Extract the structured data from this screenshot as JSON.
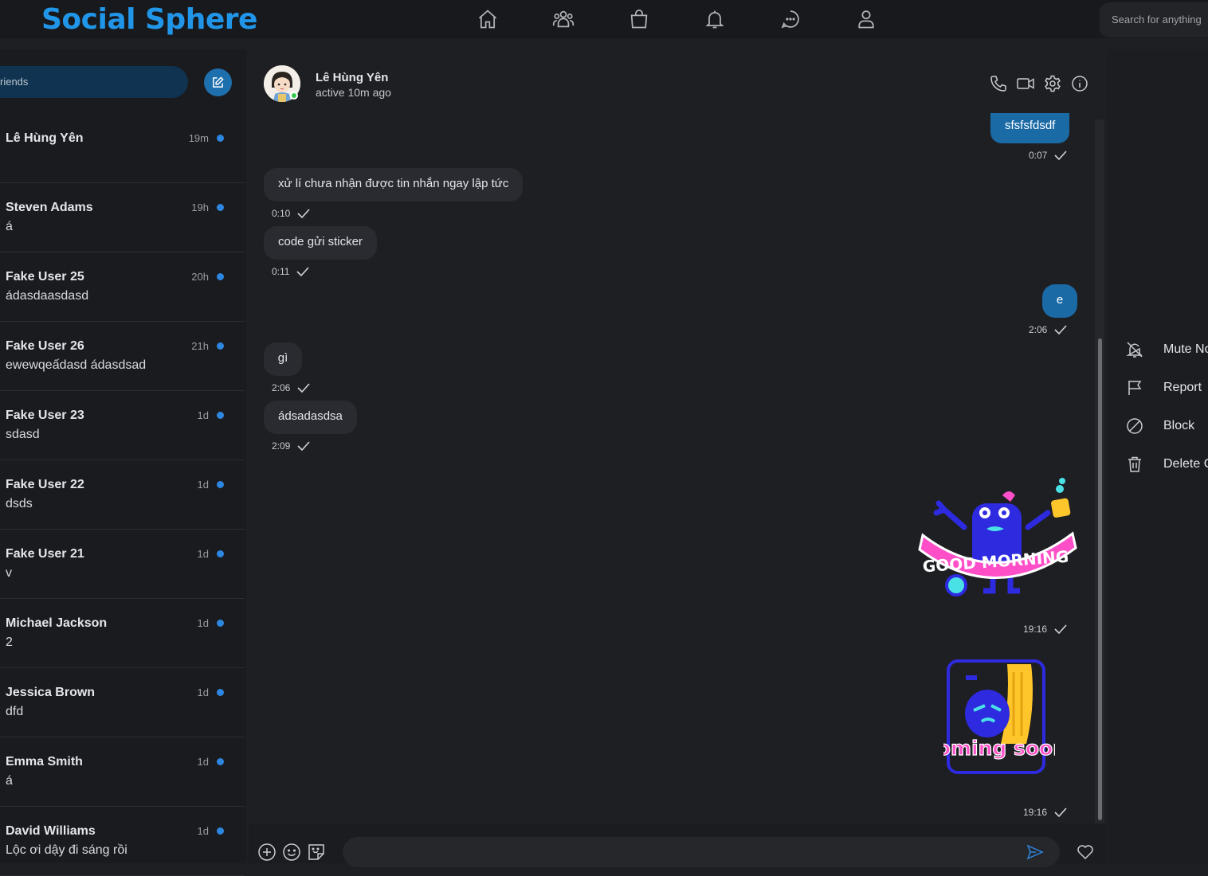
{
  "app": {
    "brand": "Social Sphere",
    "search_placeholder": "Search for anything"
  },
  "nav": [
    "home-icon",
    "friends-icon",
    "shop-icon",
    "bell-icon",
    "chat-icon",
    "profile-icon"
  ],
  "sidebar": {
    "search_placeholder": "riends",
    "conversations": [
      {
        "name": "Lê Hùng Yên",
        "preview": "",
        "time": "19m"
      },
      {
        "name": "Steven Adams",
        "preview": "á",
        "time": "19h"
      },
      {
        "name": "Fake User 25",
        "preview": "ádasdaasdasd",
        "time": "20h"
      },
      {
        "name": "Fake User 26",
        "preview": "ewewqeấdasd ádasdsad",
        "time": "21h"
      },
      {
        "name": "Fake User 23",
        "preview": "sdasd",
        "time": "1d"
      },
      {
        "name": "Fake User 22",
        "preview": "dsds",
        "time": "1d"
      },
      {
        "name": "Fake User 21",
        "preview": "v",
        "time": "1d"
      },
      {
        "name": "Michael Jackson",
        "preview": "2",
        "time": "1d"
      },
      {
        "name": "Jessica Brown",
        "preview": "dfd",
        "time": "1d"
      },
      {
        "name": "Emma Smith",
        "preview": "á",
        "time": "1d"
      },
      {
        "name": "David Williams",
        "preview": "Lộc ơi dậy đi sáng rồi",
        "time": "1d"
      }
    ]
  },
  "chat": {
    "contact_name": "Lê Hùng Yên",
    "contact_status": "active 10m ago",
    "messages": [
      {
        "direction": "out",
        "text": "sfsfsfdsdf",
        "time": "0:07"
      },
      {
        "direction": "in",
        "text": "xử lí chưa nhận được tin nhắn ngay lập tức",
        "time": "0:10"
      },
      {
        "direction": "in",
        "text": "code gửi sticker",
        "time": "0:11"
      },
      {
        "direction": "out",
        "text": "e",
        "time": "2:06"
      },
      {
        "direction": "in",
        "text": "gì",
        "time": "2:06"
      },
      {
        "direction": "in",
        "text": "ádsadasdsa",
        "time": "2:09"
      },
      {
        "direction": "out",
        "sticker": "good-morning",
        "sticker_text": "GOOD MORNING",
        "time": "19:16"
      },
      {
        "direction": "out",
        "sticker": "coming-soon",
        "sticker_text": "coming soon",
        "time": "19:16"
      }
    ]
  },
  "actions": [
    {
      "label": "Mute No",
      "icon": "bell-off-icon"
    },
    {
      "label": "Report",
      "icon": "flag-icon"
    },
    {
      "label": "Block",
      "icon": "block-icon"
    },
    {
      "label": "Delete C",
      "icon": "trash-icon"
    }
  ],
  "colors": {
    "brand": "#2196e9",
    "outgoing_bubble": "#1a6aa6",
    "unread_dot": "#2d86e0",
    "online": "#35c84a"
  }
}
